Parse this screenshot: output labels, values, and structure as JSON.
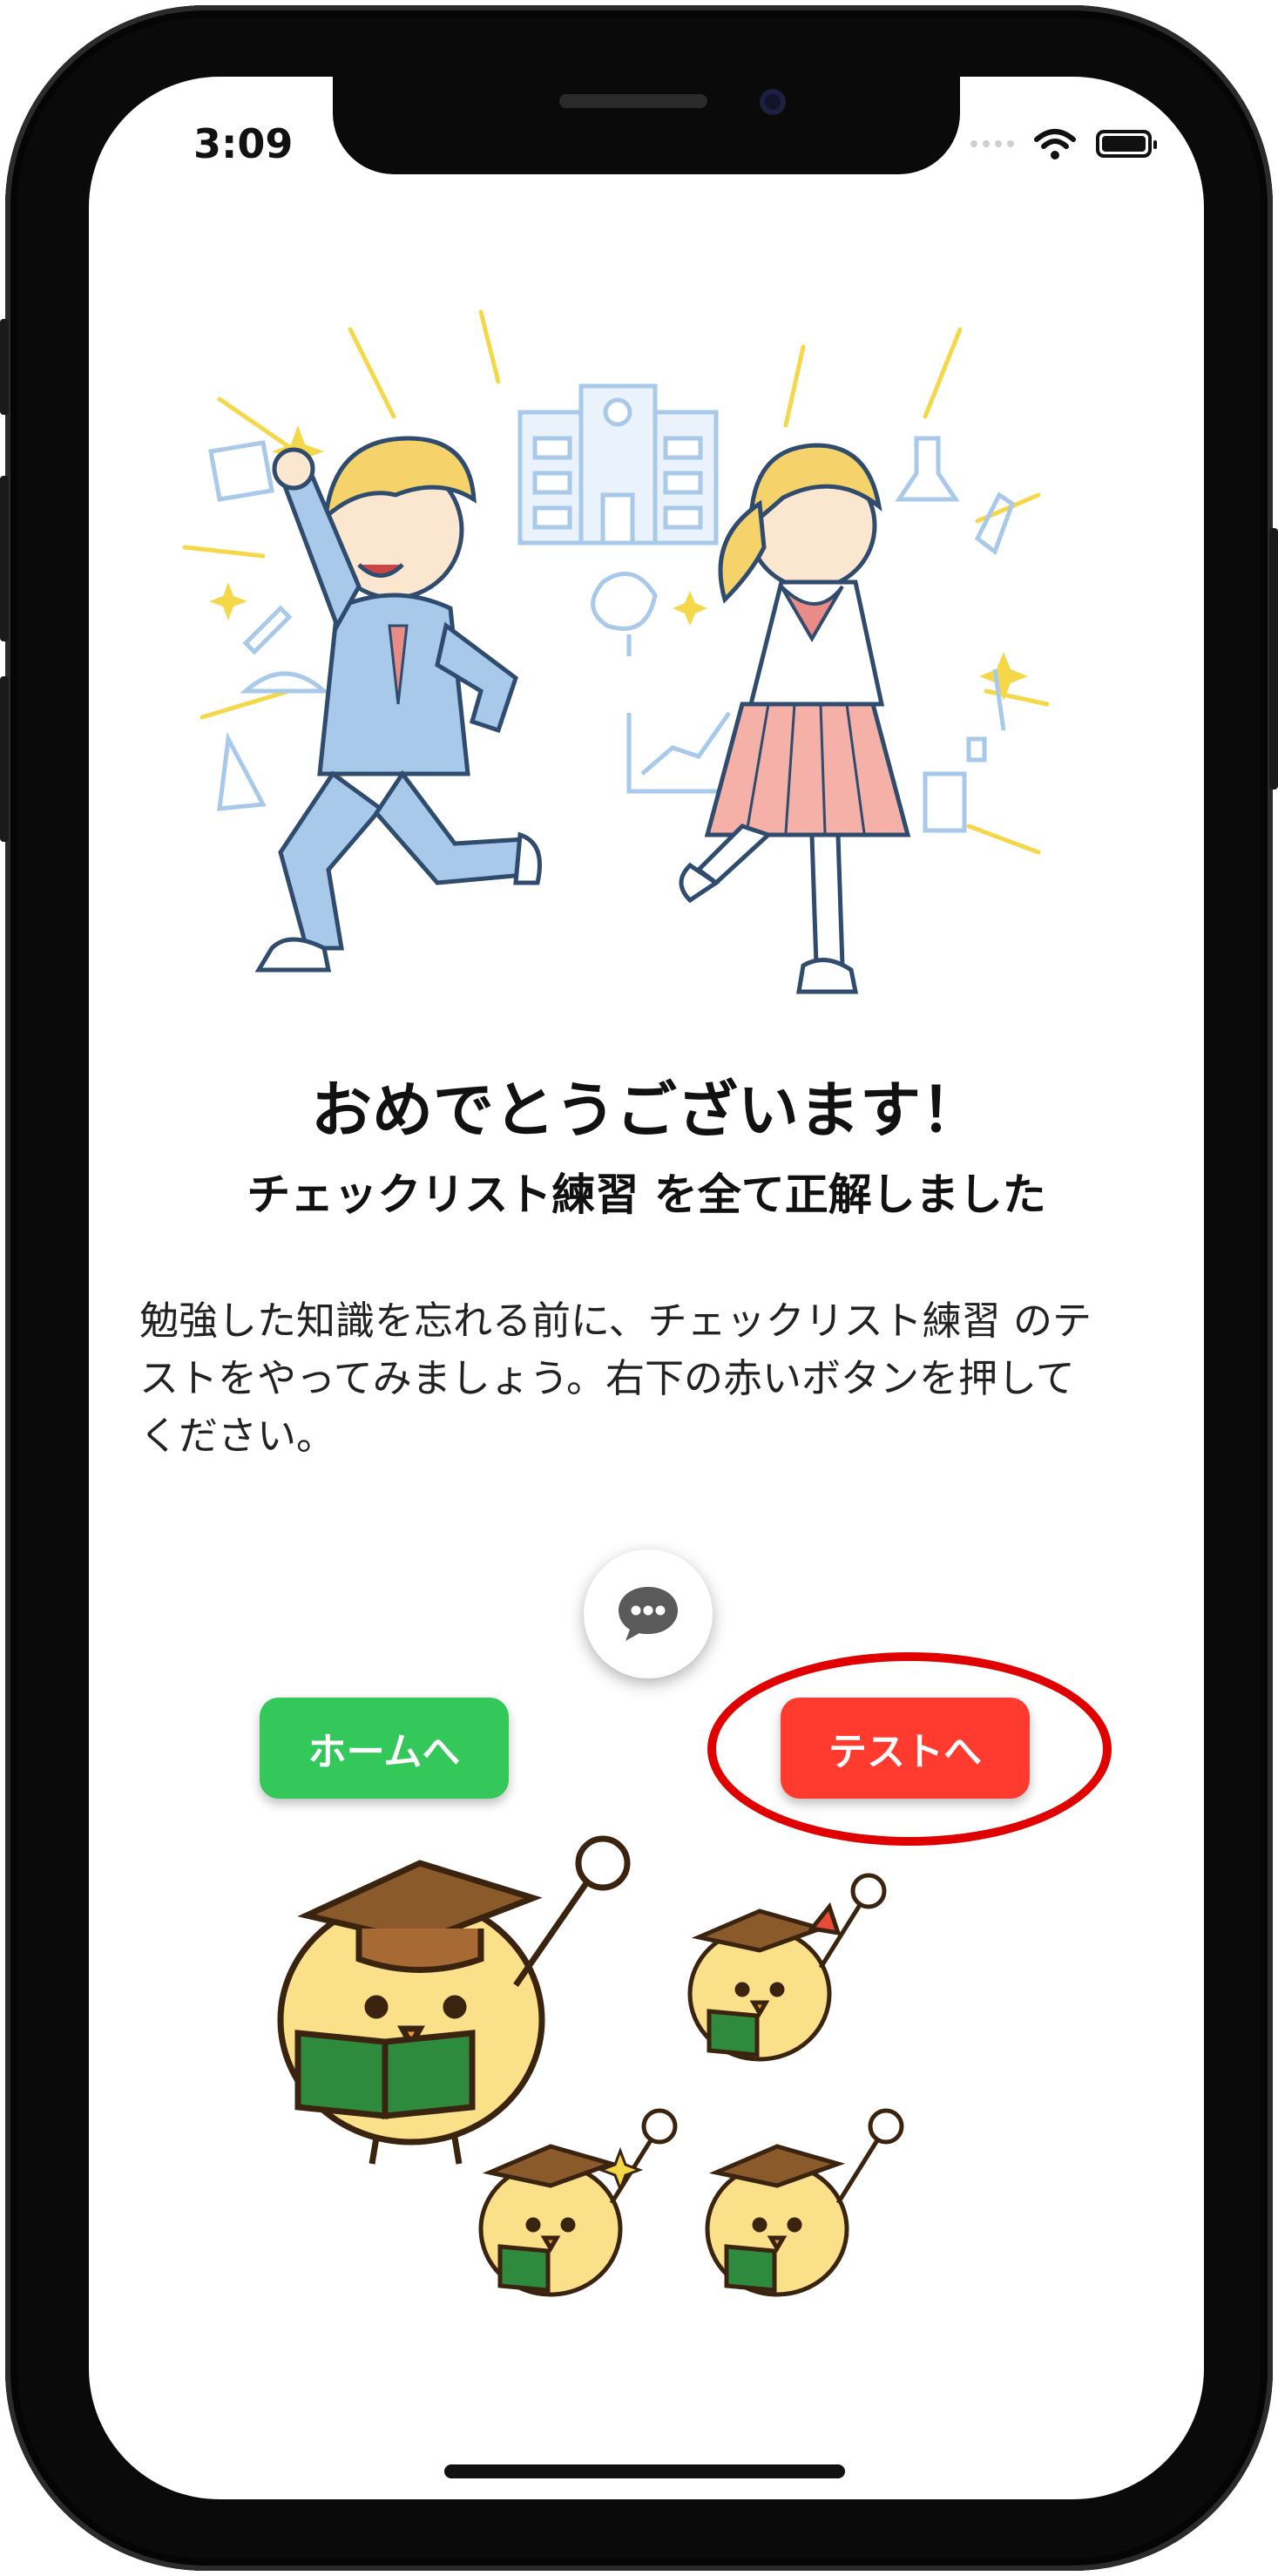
{
  "status_bar": {
    "time": "3:09"
  },
  "message": {
    "title": "おめでとうございます！",
    "subtitle": "チェックリスト練習 を全て正解しました",
    "body_lines": [
      "勉強した知識を忘れる前に、チェックリスト練習 のテ",
      "ストをやってみましょう。右下の赤いボタンを押して",
      "ください。"
    ]
  },
  "buttons": {
    "home_label": "ホームへ",
    "test_label": "テストへ"
  },
  "icons": {
    "chat": "chat-bubble-icon",
    "wifi": "wifi-icon",
    "battery": "battery-icon"
  },
  "colors": {
    "home_button": "#34c759",
    "test_button": "#ff3b30",
    "highlight": "#e00000",
    "accent_yellow": "#f5d84a",
    "accent_blue": "#a9c9ea"
  }
}
